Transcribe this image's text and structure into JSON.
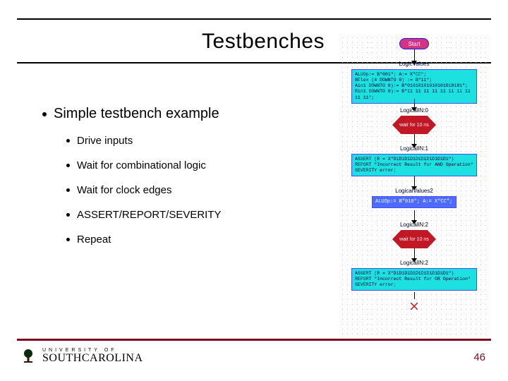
{
  "title": "Testbenches",
  "bullets": {
    "main": "Simple testbench example",
    "subs": [
      "Drive inputs",
      "Wait for combinational logic",
      "Wait for clock edges",
      "ASSERT/REPORT/SEVERITY",
      "Repeat"
    ]
  },
  "footer": {
    "univ_small": "UNIVERSITY OF",
    "univ_big": "SOUTHCAROLINA",
    "page": "46"
  },
  "flowchart": {
    "start": "Start",
    "lbl_values": "LogicValues",
    "box_assign": "ALUOp:= B\"001\"; A:= X\"CC\";\nBFlex (4 DOWNTO 0) := B\"11\";\nAin1 DOWNTO 0):= B\"01010101010101010101\";\nRin1 DOWNTO 0):= B\"11 11 11 11 11 11 11 11 11 11\";",
    "lbl_in0": "LogicalIN:0",
    "hex_wait1": "wait for 10 ns",
    "lbl_in1": "LogicalIN:1",
    "box_assert1": "ASSERT (R = X\"D1D1D1D1D1D1D1D1D1D1\")\nREPORT \"Incorrect Result for AND Operation\"\nSEVERITY error;",
    "lbl_values2": "LogicalValues2",
    "box_aluop": "ALUOp:= B\"010\"; A:= X\"CC\";",
    "lbl_in2a": "LogicalIN:2",
    "hex_wait2": "wait for 10 ns",
    "lbl_in2b": "LogicalIN:2",
    "box_assert2": "ASSERT (R = X\"D1D1D1D1D1D1D1D1D1D1\")\nREPORT \"Incorrect Result for OR Operation\"\nSEVERITY error;"
  }
}
